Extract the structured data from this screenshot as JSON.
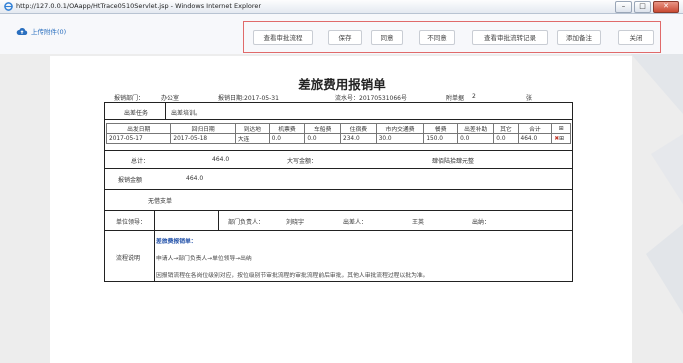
{
  "window": {
    "title": "http://127.0.0.1/OAapp/HtTrace0510Servlet.jsp - Windows Internet Explorer"
  },
  "toolbar": {
    "upload_label": "上传附件(0)",
    "buttons": [
      {
        "label": "查看审批流程"
      },
      {
        "label": "保存"
      },
      {
        "label": "同意"
      },
      {
        "label": "不同意"
      },
      {
        "label": "查看审批流转记录"
      },
      {
        "label": "添加备注"
      },
      {
        "label": "关闭"
      }
    ]
  },
  "form": {
    "title": "差旅费用报销单",
    "meta": {
      "dept_label": "报销部门：",
      "dept_value": "办公室",
      "date": "报销日期:2017-05-31",
      "serial": "流水号：20170531066号",
      "attach_label": "附单据",
      "attach_count": "2",
      "attach_unit": "张"
    },
    "task_label": "出差任务",
    "task_value": "出差培训。",
    "table": {
      "headers": [
        "出发日期",
        "回归日期",
        "到达地",
        "机票费",
        "车船费",
        "住宿费",
        "市内交通费",
        "餐费",
        "出差补助",
        "其它",
        "合计"
      ],
      "rows": [
        [
          "2017-05-17",
          "2017-05-18",
          "大连",
          "0.0",
          "0.0",
          "234.0",
          "30.0",
          "150.0",
          "0.0",
          "0.0",
          "464.0"
        ]
      ]
    },
    "total_label": "总计：",
    "total_value": "464.0",
    "upper_label": "大写金额：",
    "upper_value": "肆佰陆拾肆元整",
    "amount_label": "报销金额",
    "amount_value": "464.0",
    "no_receipt": "无借支单",
    "unit_leader_label": "单位领导：",
    "dept_head_label": "部门负责人：",
    "dept_head_value": "刘晓宇",
    "cashier_label": "出差人：",
    "cashier_value": "王英",
    "teller_label": "出纳：",
    "flow_label": "流程说明",
    "flow_title": "差旅费报销单：",
    "flow_line1": "申请人→部门负责人→单位领导→出纳",
    "flow_line2": "因报销流程在各岗位级别对应，按位级别节审批流程的审批流程前后审批，其他人审批流程过程以批为准。"
  },
  "colors": {
    "highlight_border": "#e06a6a",
    "link_blue": "#2a6fbf",
    "flow_title_blue": "#1f4fa8"
  }
}
